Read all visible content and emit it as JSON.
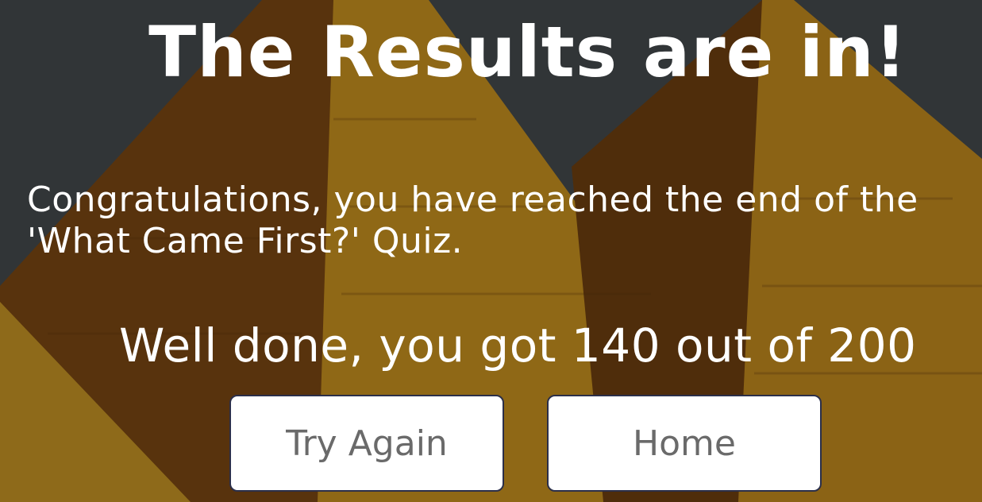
{
  "page": {
    "title": "The Results are in!",
    "congrats_message": "Congratulations, you have reached the end of the 'What Came First?' Quiz.",
    "score_message": "Well done, you got 140 out of 200",
    "score": 140,
    "max_score": 200
  },
  "actions": {
    "try_again_label": "Try Again",
    "home_label": "Home"
  },
  "colors": {
    "text": "#ffffff",
    "button_bg": "#ffffff",
    "button_text": "#6a6a6a",
    "button_border": "#2b2f4a",
    "sky": "#3f4447",
    "pyramid_light": "#b8831c",
    "pyramid_dark": "#6b3d10"
  },
  "background": {
    "icon": "pyramids-scene"
  }
}
